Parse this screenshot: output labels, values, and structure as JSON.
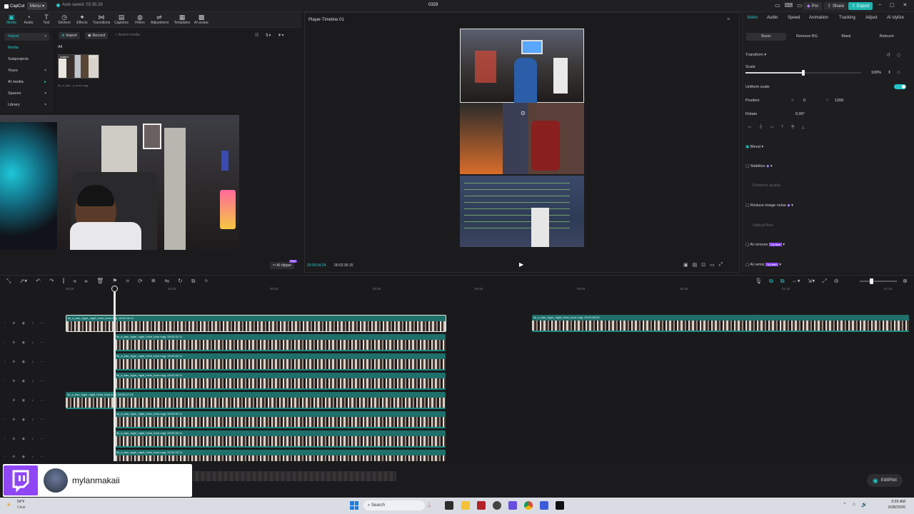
{
  "app": {
    "logo": "CapCut",
    "menu": "Menu",
    "autosave": "Auto saved: 03:35:28",
    "title": "0329",
    "pro": "Pro",
    "share": "Share",
    "export": "Export"
  },
  "toolbar": [
    {
      "label": "Media",
      "icon": "media-icon"
    },
    {
      "label": "Audio",
      "icon": "audio-icon"
    },
    {
      "label": "Text",
      "icon": "text-icon"
    },
    {
      "label": "Stickers",
      "icon": "stickers-icon"
    },
    {
      "label": "Effects",
      "icon": "effects-icon"
    },
    {
      "label": "Transitions",
      "icon": "transitions-icon"
    },
    {
      "label": "Captions",
      "icon": "captions-icon"
    },
    {
      "label": "Filters",
      "icon": "filters-icon"
    },
    {
      "label": "Adjustment",
      "icon": "adjustment-icon"
    },
    {
      "label": "Templates",
      "icon": "templates-icon"
    },
    {
      "label": "AI avatar",
      "icon": "ai-avatar-icon"
    }
  ],
  "leftnav": [
    {
      "label": "Import",
      "chev": "▾"
    },
    {
      "label": "Media",
      "chev": ""
    },
    {
      "label": "Subprojects",
      "chev": ""
    },
    {
      "label": "Yours",
      "chev": "▾"
    },
    {
      "label": "AI media",
      "chev": "▸"
    },
    {
      "label": "Spaces",
      "chev": "▾"
    },
    {
      "label": "Library",
      "chev": "▾"
    }
  ],
  "media": {
    "import": "Import",
    "record": "Record",
    "search_placeholder": "Search media",
    "filter_all": "All",
    "thumb_badge": "Added",
    "thumb_duration": "01:50",
    "thumb_name": "its_a_bau...n_bron.mpg"
  },
  "player": {
    "title": "Player-Timeline 01",
    "time_current": "00:00:04:24",
    "time_total": "00:02:35:15",
    "ai_clipper": "AI clipper",
    "free": "Free"
  },
  "props": {
    "tabs": [
      "Video",
      "Audio",
      "Speed",
      "Animation",
      "Tracking",
      "Adjust",
      "AI stylize"
    ],
    "subtabs": [
      "Basic",
      "Remove BG",
      "Mask",
      "Retouch"
    ],
    "transform": "Transform",
    "scale": "Scale",
    "scale_value": "100%",
    "scale_level": 0.5,
    "uniform": "Uniform scale",
    "position": "Position",
    "pos_x": "0",
    "pos_y": "1269",
    "rotate": "Rotate",
    "rotate_value": "0.00°",
    "blend": "Blend",
    "stabilize": "Stabilize",
    "enhance": "Enhance quality",
    "reduce_noise": "Reduce image noise",
    "optical_flow": "Optical flow",
    "ai_remove": "AI remove",
    "ai_remix": "AI remix",
    "try_free": "Try free"
  },
  "timeline": {
    "ruler": [
      "00:00",
      "00:10",
      "00:20",
      "00:30",
      "00:40",
      "00:50",
      "01:00",
      "01:10",
      "01:20"
    ],
    "clip_name": "its_a_bau_hype_night_heim_bron.mpg",
    "clip_dur_main": "00:02:32:11",
    "clip_dur_second": "00:01:50:00",
    "clip_dur_short": "00:00:27:03",
    "tracks": 8
  },
  "overlay": {
    "twitch_user": "mylanmakaii",
    "editpilot": "EditPilot"
  },
  "taskbar": {
    "temp": "54°F",
    "weather": "Clear",
    "search": "Search",
    "time": "3:35 AM",
    "date": "3/28/2026"
  }
}
